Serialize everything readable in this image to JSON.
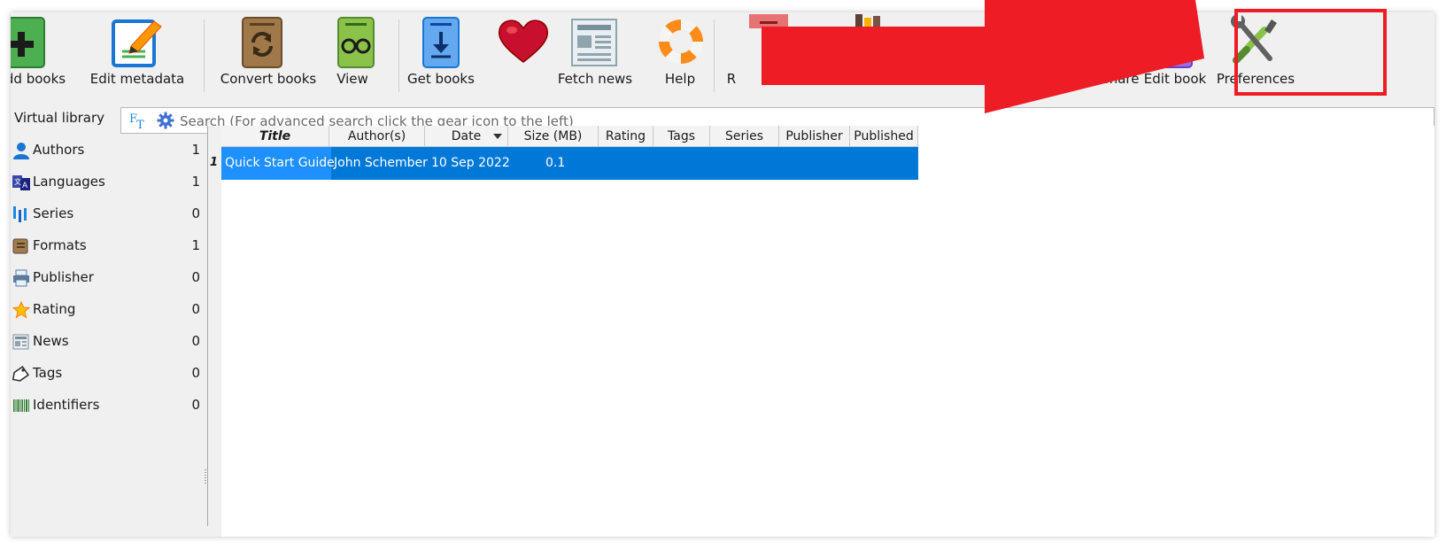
{
  "toolbar": {
    "add_books": "dd books",
    "edit_metadata": "Edit metadata",
    "convert_books": "Convert books",
    "view": "View",
    "get_books": "Get books",
    "fetch_news": "Fetch news",
    "help": "Help",
    "remove_partial": "R",
    "connect_share": "nnect/share",
    "edit_book": "Edit book",
    "preferences": "Preferences"
  },
  "search": {
    "virtual_library": "Virtual library",
    "ft_label": "FT",
    "placeholder": "Search (For advanced search click the gear icon to the left)"
  },
  "tag_browser": {
    "items": [
      {
        "label": "Authors",
        "count": "1",
        "icon": "person-icon"
      },
      {
        "label": "Languages",
        "count": "1",
        "icon": "language-icon"
      },
      {
        "label": "Series",
        "count": "0",
        "icon": "series-icon"
      },
      {
        "label": "Formats",
        "count": "1",
        "icon": "book-icon"
      },
      {
        "label": "Publisher",
        "count": "0",
        "icon": "printer-icon"
      },
      {
        "label": "Rating",
        "count": "0",
        "icon": "star-icon"
      },
      {
        "label": "News",
        "count": "0",
        "icon": "news-icon"
      },
      {
        "label": "Tags",
        "count": "0",
        "icon": "tag-icon"
      },
      {
        "label": "Identifiers",
        "count": "0",
        "icon": "barcode-icon"
      }
    ]
  },
  "book_list": {
    "columns": [
      "Title",
      "Author(s)",
      "Date",
      "Size (MB)",
      "Rating",
      "Tags",
      "Series",
      "Publisher",
      "Published"
    ],
    "rows": [
      {
        "num": "1",
        "title": "Quick Start Guide",
        "authors": "John Schember",
        "date": "10 Sep 2022",
        "size": "0.1",
        "rating": "",
        "tags": "",
        "series": "",
        "publisher": "",
        "published": ""
      }
    ]
  },
  "colors": {
    "selection": "#0078d7",
    "annotation_red": "#ee1c25"
  }
}
